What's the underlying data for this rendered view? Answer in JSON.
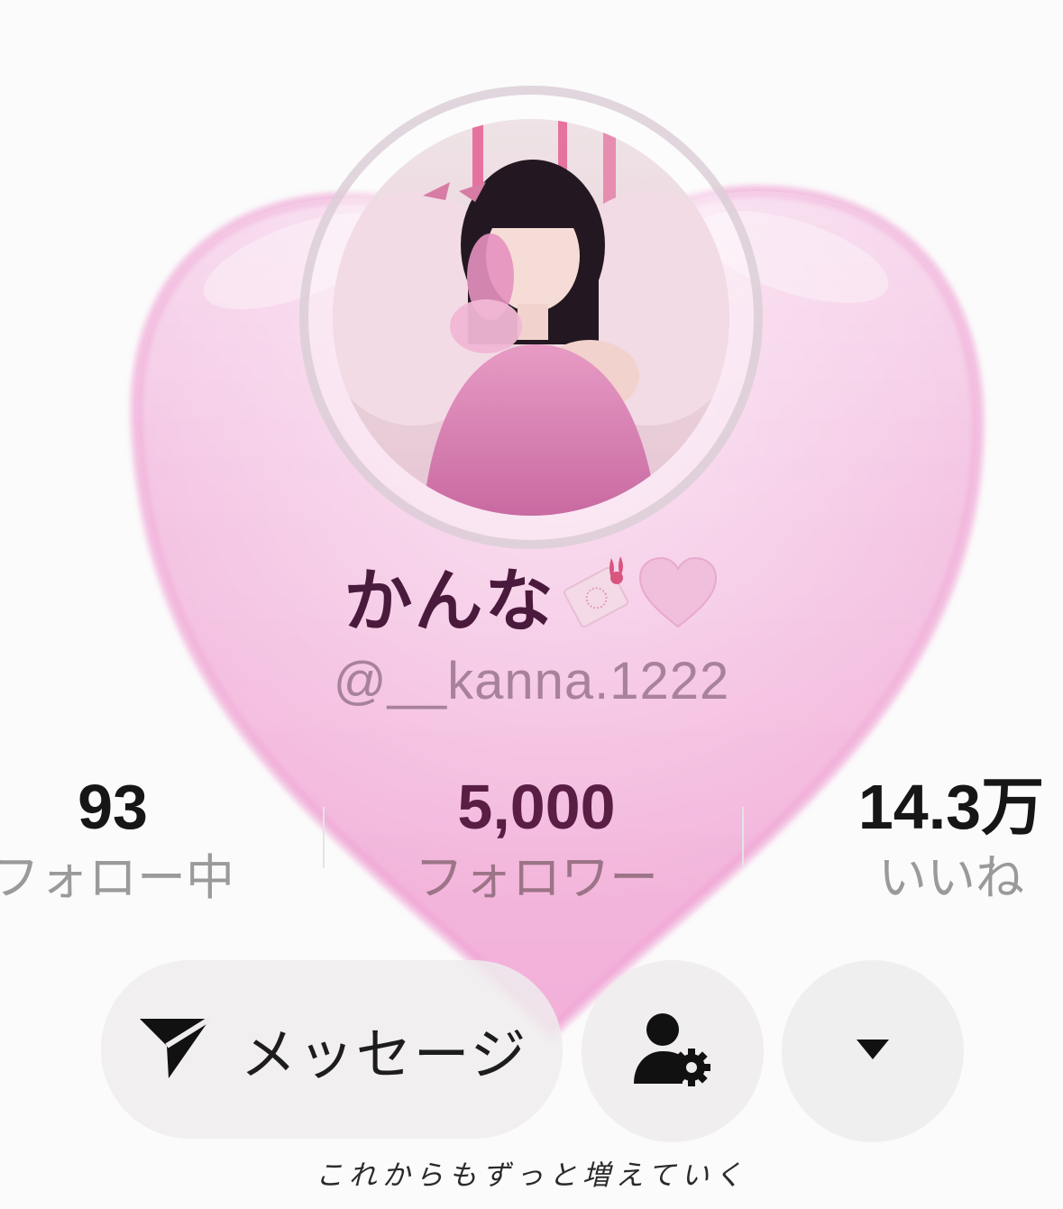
{
  "profile": {
    "display_name": "かんな",
    "name_emoji_1": "ticket-with-bunny-emoji",
    "name_emoji_2": "pink-heart-emoji",
    "handle": "@__kanna.1222"
  },
  "stats": {
    "following": {
      "value": "93",
      "label": "フォロー中"
    },
    "followers": {
      "value": "5,000",
      "label": "フォロワー"
    },
    "likes": {
      "value": "14.3万",
      "label": "いいね"
    }
  },
  "actions": {
    "message_label": "メッセージ",
    "message_icon": "send-icon",
    "friends_icon": "user-settings-icon",
    "more_icon": "caret-down-icon"
  },
  "overlay": {
    "caption": "これからもずっと増えていく",
    "heart_color": "#f4b4dc"
  }
}
